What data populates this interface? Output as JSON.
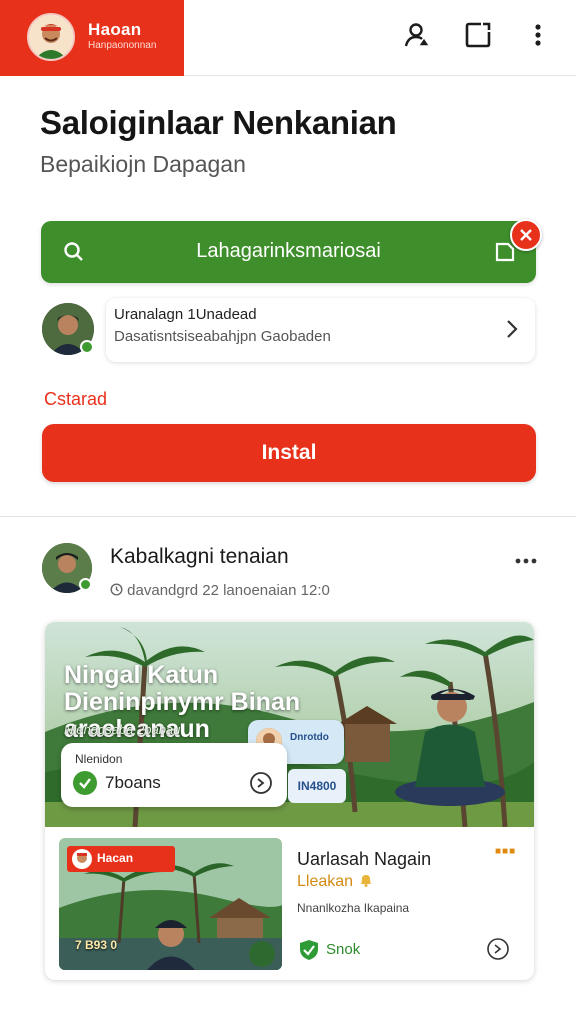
{
  "header": {
    "brand_title": "Haoan",
    "brand_subtitle": "Hanpaononnan",
    "icons": [
      "add-user-icon",
      "share-icon",
      "more-vertical-icon"
    ]
  },
  "page": {
    "title": "Saloiginlaar Nenkanian",
    "subtitle": "Bepaikiojn Dapagan"
  },
  "search": {
    "text": "Lahagarinksmariosai"
  },
  "profile": {
    "name": "Uranalagn 1Unadead",
    "description": "Dasatisntsiseabahjpn Gaobaden"
  },
  "status_label": "Cstarad",
  "install_label": "Instal",
  "post": {
    "author": "Kabalkagni tenaian",
    "timestamp": "davandgrd 22 lanoenaian 12:0",
    "banner": {
      "title": "Ningal Katun Dieninpinymr Binan araeleanaun",
      "caption": "Nlenggsaba 2babau"
    },
    "mini_card": {
      "label": "Nlenidon",
      "value": "7boans"
    },
    "chip": {
      "text": "Dnrotdo"
    },
    "badge": "IN4800",
    "card": {
      "thumb_brand": "Hacan",
      "thumb_caption": "7 B93 0",
      "title": "Uarlasah Nagain",
      "subtitle": "Lleakan",
      "description": "Nnanlkozha Ikapaina",
      "action": "Snok"
    }
  },
  "colors": {
    "brand_red": "#e8311b",
    "green": "#3e8f2c",
    "amber": "#d48b14"
  }
}
